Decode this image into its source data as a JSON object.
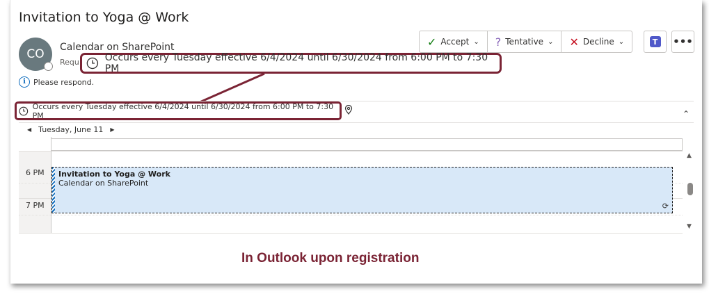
{
  "email": {
    "subject": "Invitation to Yoga @ Work",
    "avatar_initials": "CO",
    "sender": "Calendar on SharePoint",
    "required_prefix": "Requ",
    "respond_text": "Please respond."
  },
  "actions": {
    "accept_label": "Accept",
    "tentative_label": "Tentative",
    "decline_label": "Decline",
    "teams_icon": "teams-icon",
    "more_label": "•••"
  },
  "recurrence": {
    "text": "Occurs every Tuesday effective 6/4/2024 until 6/30/2024 from 6:00 PM to 7:30 PM"
  },
  "calendar": {
    "date_label": "Tuesday, June 11",
    "hours": [
      "6 PM",
      "7 PM"
    ],
    "event": {
      "title": "Invitation to Yoga @ Work",
      "location": "Calendar on SharePoint"
    }
  },
  "caption": "In Outlook upon registration",
  "colors": {
    "highlight_border": "#7a2334",
    "event_fill": "#d8e8f8",
    "accept_check": "#107c10",
    "decline_x": "#c50f1f",
    "tentative_q": "#8764b8"
  }
}
